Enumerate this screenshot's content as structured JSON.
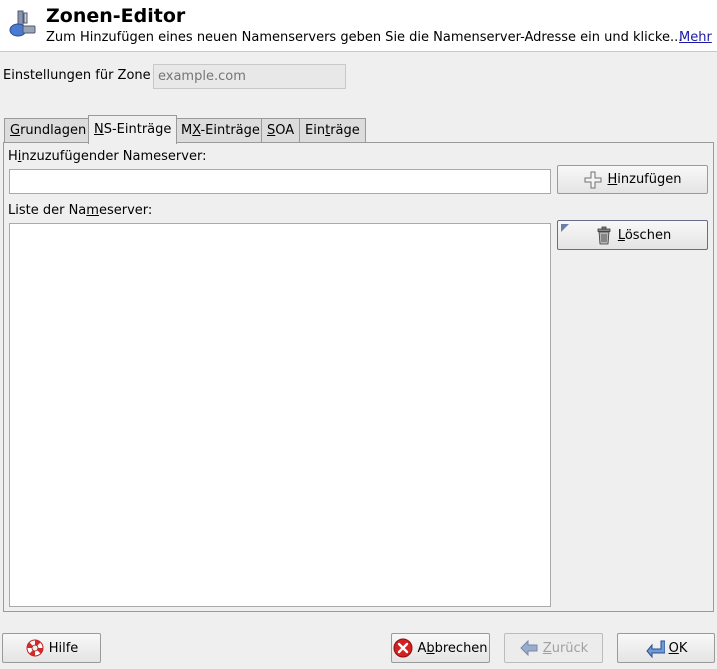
{
  "header": {
    "title": "Zonen-Editor",
    "description": "Zum Hinzufügen eines neuen Namenservers geben Sie die Namenserver-Adresse ein und klicke...",
    "more_link": "Mehr"
  },
  "zone": {
    "label": "Einstellungen für Zone",
    "placeholder": "example.com"
  },
  "tabs": [
    {
      "pre": "",
      "key": "G",
      "post": "rundlagen"
    },
    {
      "pre": "",
      "key": "N",
      "post": "S-Einträge"
    },
    {
      "pre": "M",
      "key": "X",
      "post": "-Einträge"
    },
    {
      "pre": "",
      "key": "S",
      "post": "OA"
    },
    {
      "pre": "Ein",
      "key": "t",
      "post": "räge"
    }
  ],
  "active_tab": "NS-Einträge",
  "ns": {
    "add_label": {
      "pre": "H",
      "key": "i",
      "post": "nzuzufügender Nameserver:"
    },
    "add_value": "",
    "list_label": {
      "pre": "Liste der Na",
      "key": "m",
      "post": "eserver:"
    },
    "list_items": [],
    "add_button": {
      "pre": "",
      "key": "H",
      "post": "inzufügen"
    },
    "delete_button": {
      "pre": "",
      "key": "L",
      "post": "öschen"
    }
  },
  "footer": {
    "help": {
      "pre": "",
      "key": "",
      "post": "Hilfe"
    },
    "cancel": {
      "pre": "A",
      "key": "b",
      "post": "brechen"
    },
    "back": {
      "pre": "",
      "key": "Z",
      "post": "urück"
    },
    "ok": {
      "pre": "",
      "key": "O",
      "post": "K"
    }
  },
  "colors": {
    "background": "#efefef",
    "link": "#1a1aa6",
    "cancel_icon": "#d42020",
    "arrow_icon": "#4a6fb0"
  }
}
